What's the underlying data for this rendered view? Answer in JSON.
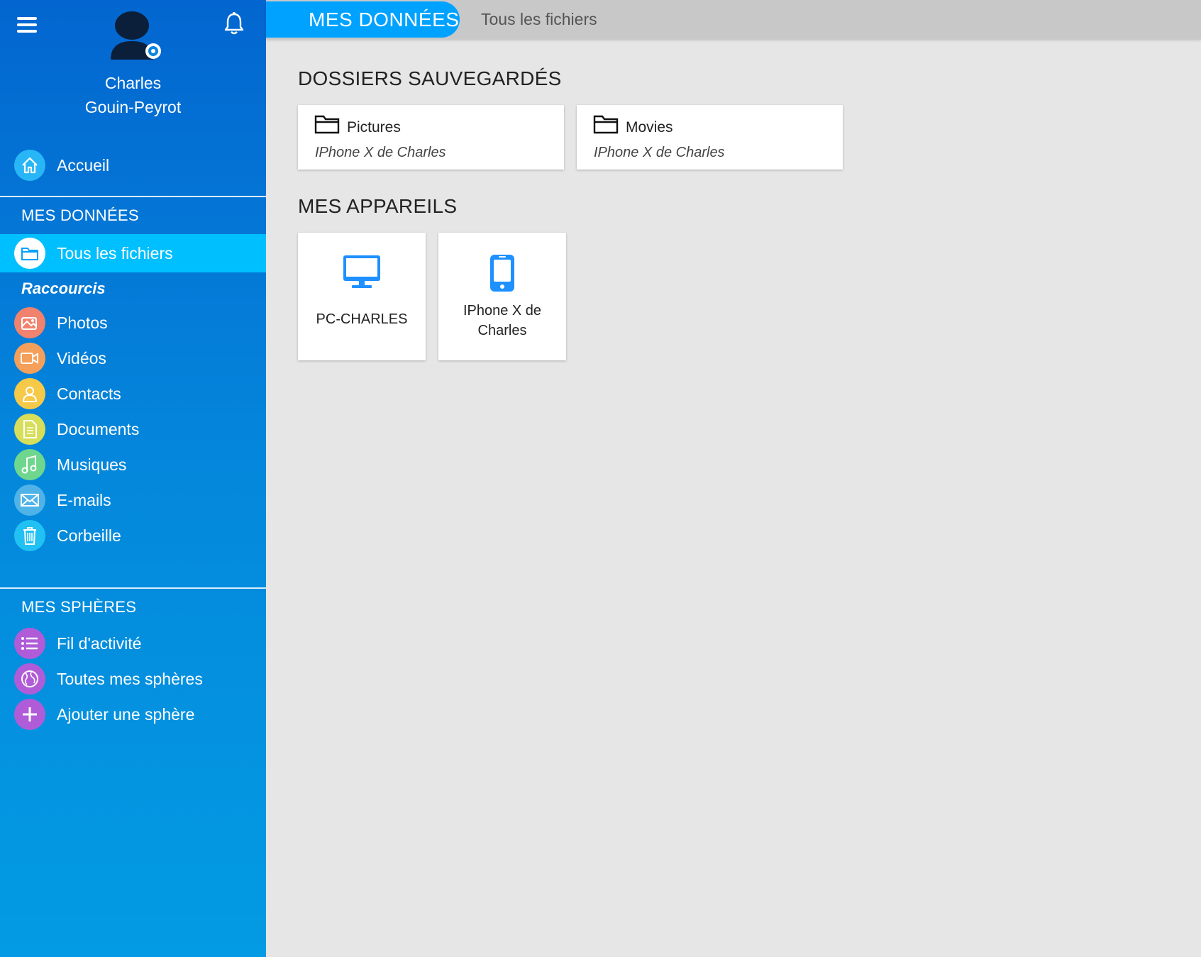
{
  "sidebar": {
    "user_name_line1": "Charles",
    "user_name_line2": "Gouin-Peyrot",
    "home": {
      "label": "Accueil",
      "icon": "home-icon",
      "color": "#29b6f6"
    },
    "mes_donnees": {
      "title": "MES DONNÉES",
      "all_files": {
        "label": "Tous les fichiers",
        "icon": "folder-icon"
      },
      "shortcuts_title": "Raccourcis",
      "items": [
        {
          "label": "Photos",
          "icon": "image-icon",
          "color": "#f0826e"
        },
        {
          "label": "Vidéos",
          "icon": "video-icon",
          "color": "#f5a05a"
        },
        {
          "label": "Contacts",
          "icon": "user-icon",
          "color": "#f7c948"
        },
        {
          "label": "Documents",
          "icon": "document-icon",
          "color": "#d7de5a"
        },
        {
          "label": "Musiques",
          "icon": "music-icon",
          "color": "#6fd68e"
        },
        {
          "label": "E-mails",
          "icon": "mail-icon",
          "color": "#4fb3e8"
        },
        {
          "label": "Corbeille",
          "icon": "trash-icon",
          "color": "#21c1f3"
        }
      ]
    },
    "mes_spheres": {
      "title": "MES SPHÈRES",
      "items": [
        {
          "label": "Fil d'activité",
          "icon": "list-icon",
          "color": "#b05cd8"
        },
        {
          "label": "Toutes mes sphères",
          "icon": "globe-icon",
          "color": "#b05cd8"
        },
        {
          "label": "Ajouter une sphère",
          "icon": "plus-icon",
          "color": "#b05cd8"
        }
      ]
    }
  },
  "topbar": {
    "active_tab": "MES DONNÉES",
    "breadcrumb": "Tous les fichiers"
  },
  "main": {
    "saved_folders_title": "DOSSIERS SAUVEGARDÉS",
    "folders": [
      {
        "name": "Pictures",
        "device": "IPhone X de Charles"
      },
      {
        "name": "Movies",
        "device": "IPhone X de Charles"
      }
    ],
    "devices_title": "MES APPAREILS",
    "devices": [
      {
        "name": "PC-CHARLES",
        "icon": "desktop-icon"
      },
      {
        "name_line1": "IPhone X de",
        "name_line2": "Charles",
        "icon": "smartphone-icon"
      }
    ]
  },
  "colors": {
    "accent": "#00a2ff",
    "active_item": "#00bfff",
    "sidebar_top": "#0366d0",
    "device_icon": "#1e90ff"
  }
}
